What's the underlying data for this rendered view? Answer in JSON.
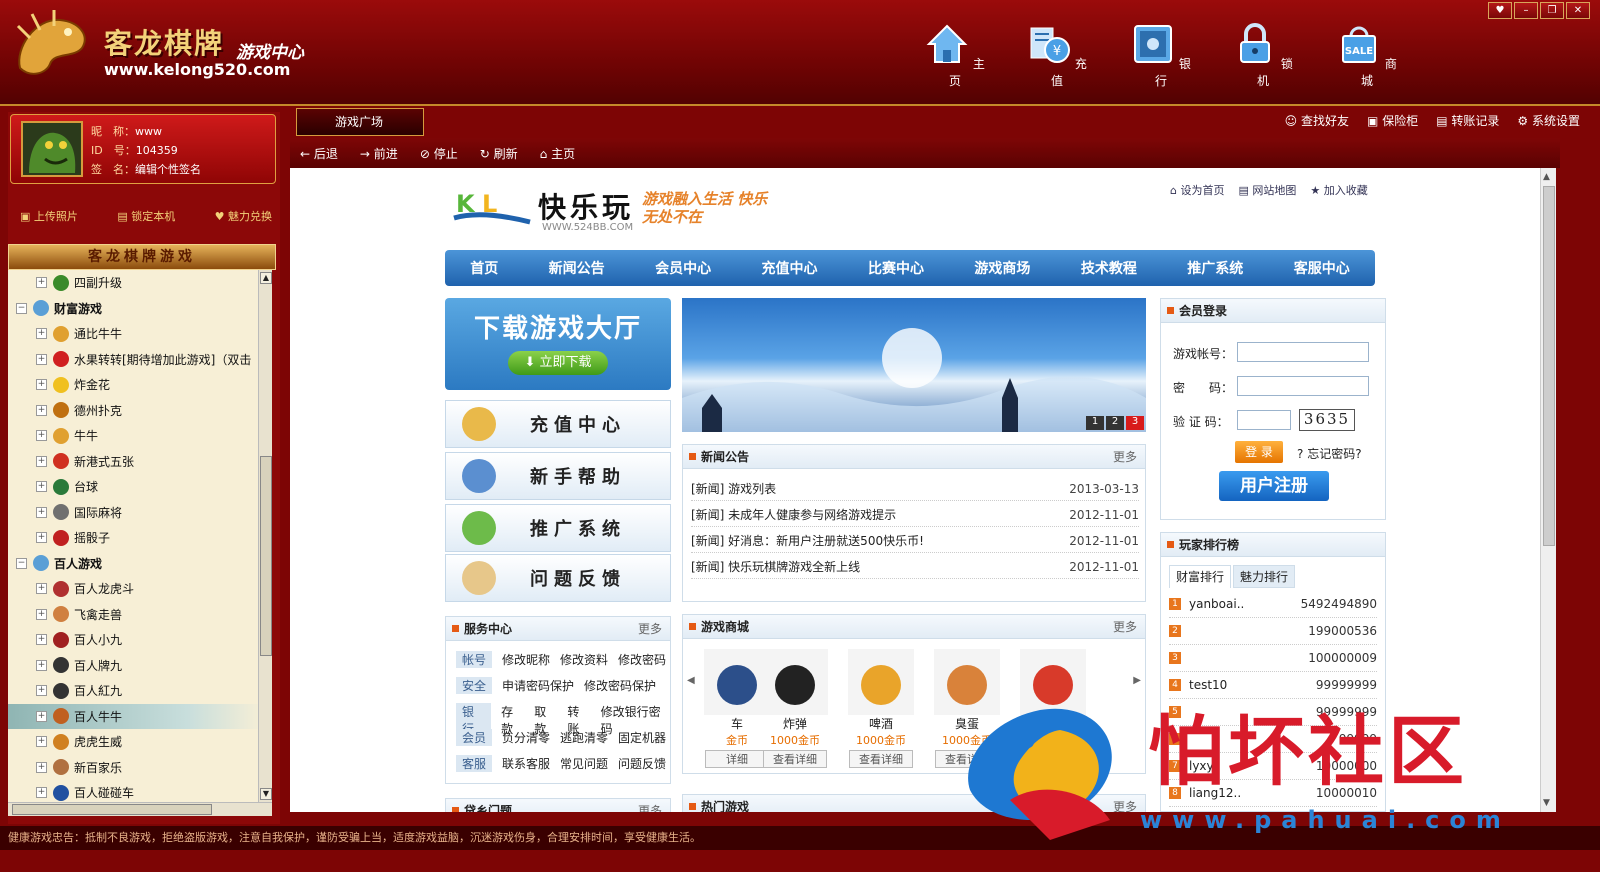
{
  "app": {
    "title_main": "客龙棋牌",
    "title_sub": "游戏中心",
    "url": "www.kelong520.com",
    "nav": [
      {
        "label": "主页",
        "icon": "home-icon"
      },
      {
        "label": "充值",
        "icon": "recharge-icon"
      },
      {
        "label": "银行",
        "icon": "bank-icon"
      },
      {
        "label": "锁机",
        "icon": "lock-icon"
      },
      {
        "label": "商城",
        "icon": "shop-icon"
      }
    ]
  },
  "profile": {
    "nick_label": "昵　称：",
    "nick": "www",
    "id_label": "ID　号：",
    "id": "104359",
    "sign_label": "签　名：",
    "sign": "编辑个性签名",
    "actions": [
      "上传照片",
      "锁定本机",
      "魅力兑换"
    ]
  },
  "games_banner": "客龙棋牌游戏",
  "tree": [
    {
      "label": "四副升级",
      "level": 2,
      "color": "#3a8a2a"
    },
    {
      "label": "财富游戏",
      "level": 1,
      "group": true
    },
    {
      "label": "通比牛牛",
      "level": 2,
      "color": "#e0a030"
    },
    {
      "label": "水果转转[期待增加此游戏]（双击",
      "level": 2,
      "color": "#d02020"
    },
    {
      "label": "炸金花",
      "level": 2,
      "color": "#f0c020"
    },
    {
      "label": "德州扑克",
      "level": 2,
      "color": "#c07010"
    },
    {
      "label": "牛牛",
      "level": 2,
      "color": "#e0a030"
    },
    {
      "label": "新港式五张",
      "level": 2,
      "color": "#d03020"
    },
    {
      "label": "台球",
      "level": 2,
      "color": "#2a7a3a"
    },
    {
      "label": "国际麻将",
      "level": 2,
      "color": "#707070"
    },
    {
      "label": "摇骰子",
      "level": 2,
      "color": "#c02020"
    },
    {
      "label": "百人游戏",
      "level": 1,
      "group": true
    },
    {
      "label": "百人龙虎斗",
      "level": 2,
      "color": "#b03030"
    },
    {
      "label": "飞禽走兽",
      "level": 2,
      "color": "#d08040"
    },
    {
      "label": "百人小九",
      "level": 2,
      "color": "#a02020"
    },
    {
      "label": "百人牌九",
      "level": 2,
      "color": "#333333"
    },
    {
      "label": "百人紅九",
      "level": 2,
      "color": "#333333"
    },
    {
      "label": "百人牛牛",
      "level": 2,
      "color": "#c06020",
      "selected": true
    },
    {
      "label": "虎虎生威",
      "level": 2,
      "color": "#d08020"
    },
    {
      "label": "新百家乐",
      "level": 2,
      "color": "#b07040"
    },
    {
      "label": "百人碰碰车",
      "level": 2,
      "color": "#2050a0"
    }
  ],
  "tab": {
    "label": "游戏广场"
  },
  "right_tools": [
    "查找好友",
    "保险柜",
    "转账记录",
    "系统设置"
  ],
  "toolbar": [
    "后退",
    "前进",
    "停止",
    "刷新",
    "主页"
  ],
  "site": {
    "name": "快乐玩",
    "url": "WWW.524BB.COM",
    "slogan": "游戏融入生活 快乐无处不在",
    "top_links": [
      "设为首页",
      "网站地图",
      "加入收藏"
    ],
    "nav": [
      "首页",
      "新闻公告",
      "会员中心",
      "充值中心",
      "比赛中心",
      "游戏商场",
      "技术教程",
      "推广系统",
      "客服中心"
    ],
    "download": {
      "title": "下载游戏大厅",
      "button": "立即下载"
    },
    "quick": [
      "充值中心",
      "新手帮助",
      "推广系统",
      "问题反馈"
    ],
    "banner_pages": [
      "1",
      "2",
      "3"
    ],
    "news": {
      "title": "新闻公告",
      "more": "更多",
      "items": [
        {
          "text": "[新闻] 游戏列表",
          "date": "2013-03-13"
        },
        {
          "text": "[新闻] 未成年人健康参与网络游戏提示",
          "date": "2012-11-01"
        },
        {
          "text": "[新闻] 好消息：新用户注册就送500快乐币!",
          "date": "2012-11-01"
        },
        {
          "text": "[新闻] 快乐玩棋牌游戏全新上线",
          "date": "2012-11-01"
        }
      ]
    },
    "service": {
      "title": "服务中心",
      "more": "更多",
      "rows": [
        {
          "tag": "帐号",
          "links": [
            "修改昵称",
            "修改资料",
            "修改密码"
          ]
        },
        {
          "tag": "安全",
          "links": [
            "申请密码保护",
            "修改密码保护"
          ]
        },
        {
          "tag": "银行",
          "links": [
            "存款",
            "取款",
            "转账",
            "修改银行密码"
          ]
        },
        {
          "tag": "会员",
          "links": [
            "负分清零",
            "逃跑清零",
            "固定机器"
          ]
        },
        {
          "tag": "客服",
          "links": [
            "联系客服",
            "常见问题",
            "问题反馈"
          ]
        }
      ]
    },
    "shop": {
      "title": "游戏商城",
      "more": "更多",
      "items": [
        {
          "name": "车",
          "price": "金币",
          "detail": "详细"
        },
        {
          "name": "炸弹",
          "price": "1000金币",
          "detail": "查看详细"
        },
        {
          "name": "啤酒",
          "price": "1000金币",
          "detail": "查看详细"
        },
        {
          "name": "臭蛋",
          "price": "1000金币",
          "detail": "查看详细"
        },
        {
          "name": "",
          "price": "金币",
          "detail": "查"
        }
      ]
    },
    "hot_games": {
      "title": "热门游戏",
      "more": "更多"
    },
    "player_service": {
      "title": "贷乡门题",
      "more": "更多"
    },
    "login": {
      "title": "会员登录",
      "account_label": "游戏帐号：",
      "password_label": "密　　码：",
      "captcha_label": "验 证 码：",
      "captcha": "3635",
      "login_btn": "登 录",
      "forgot": "忘记密码?",
      "register_btn": "用户注册"
    },
    "ranking": {
      "title": "玩家排行榜",
      "tabs": [
        "财富排行",
        "魅力排行"
      ],
      "rows": [
        {
          "rank": "1",
          "name": "yanboai..",
          "value": "5492494890"
        },
        {
          "rank": "2",
          "name": "",
          "value": "199000536"
        },
        {
          "rank": "3",
          "name": "",
          "value": "100000009"
        },
        {
          "rank": "4",
          "name": "test10",
          "value": "99999999"
        },
        {
          "rank": "5",
          "name": "",
          "value": "99999999"
        },
        {
          "rank": "6",
          "name": "",
          "value": "99999"
        },
        {
          "rank": "7",
          "name": "lyxyl",
          "value": "10000000"
        },
        {
          "rank": "8",
          "name": "liang12..",
          "value": "10000010"
        }
      ]
    }
  },
  "status": "健康游戏忠告：抵制不良游戏，拒绝盗版游戏，注意自我保护，谨防受骗上当，适度游戏益脑，沉迷游戏伤身，合理安排时间，享受健康生活。",
  "watermark": {
    "text": "怕坏社区",
    "url": "www.pahuai.com"
  },
  "colors": {
    "frame": "#7d0505",
    "nav_blue": "#1f62ad",
    "accent_orange": "#e8761d",
    "gold": "#d59b3d"
  }
}
